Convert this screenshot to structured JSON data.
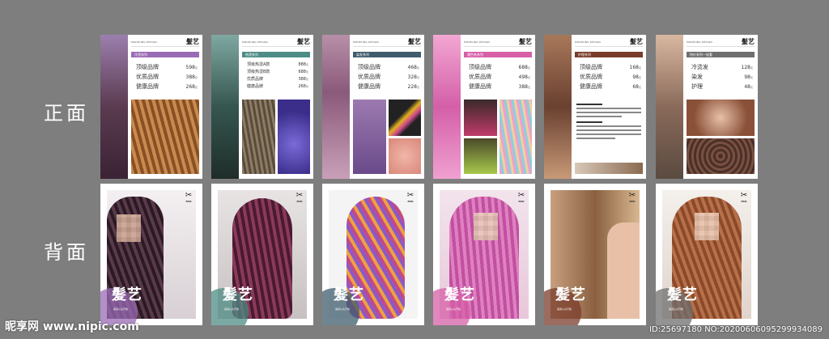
{
  "side_labels": {
    "front": "正面",
    "back": "背面"
  },
  "brand": "髪艺",
  "header_tiny": "MODELING DESIGN",
  "back_logo_text": "FATI",
  "back_title": "髪艺",
  "back_subtitle": "美丽从头开始",
  "front_cards": [
    {
      "series": "冷烫系列",
      "bar_color": "#9a6bb5",
      "items": [
        {
          "name": "顶级品牌",
          "price": "598",
          "unit": "元"
        },
        {
          "name": "优质品牌",
          "price": "388",
          "unit": "元"
        },
        {
          "name": "健康品牌",
          "price": "268",
          "unit": "元"
        }
      ]
    },
    {
      "series": "热烫系列",
      "bar_color": "#4e8c86",
      "items": [
        {
          "name": "顶级热烫A款",
          "price": "888",
          "unit": "元"
        },
        {
          "name": "顶级热烫B款",
          "price": "688",
          "unit": "元"
        },
        {
          "name": "优质品牌",
          "price": "388",
          "unit": "元"
        },
        {
          "name": "健康品牌",
          "price": "268",
          "unit": "元"
        }
      ]
    },
    {
      "series": "染发系列",
      "bar_color": "#3f5c6c",
      "items": [
        {
          "name": "顶级品牌",
          "price": "468",
          "unit": "元"
        },
        {
          "name": "优质品牌",
          "price": "328",
          "unit": "元"
        },
        {
          "name": "健康品牌",
          "price": "228",
          "unit": "元"
        }
      ]
    },
    {
      "series": "潮色系系列",
      "bar_color": "#d65fa7",
      "items": [
        {
          "name": "顶级品牌",
          "price": "688",
          "unit": "元"
        },
        {
          "name": "优质品牌",
          "price": "498",
          "unit": "元"
        },
        {
          "name": "健康品牌",
          "price": "388",
          "unit": "元"
        }
      ]
    },
    {
      "series": "护理系列",
      "bar_color": "#7a3b2a",
      "items": [
        {
          "name": "顶级品牌",
          "price": "168",
          "unit": "元"
        },
        {
          "name": "优质品牌",
          "price": "98",
          "unit": "元"
        },
        {
          "name": "健康品牌",
          "price": "68",
          "unit": "元"
        }
      ]
    },
    {
      "series": "特价系列—轻奢",
      "bar_color": "#6f6f6f",
      "items": [
        {
          "name": "冷烫发",
          "price": "128",
          "unit": "元"
        },
        {
          "name": "染发",
          "price": "98",
          "unit": "元"
        },
        {
          "name": "护理",
          "price": "48",
          "unit": "元"
        }
      ]
    }
  ],
  "watermark": {
    "left": "昵享网 www.nipic.com",
    "right": "ID:25697180 NO:20200606095299934089"
  },
  "colors": {
    "background": "#7e7e7e"
  }
}
